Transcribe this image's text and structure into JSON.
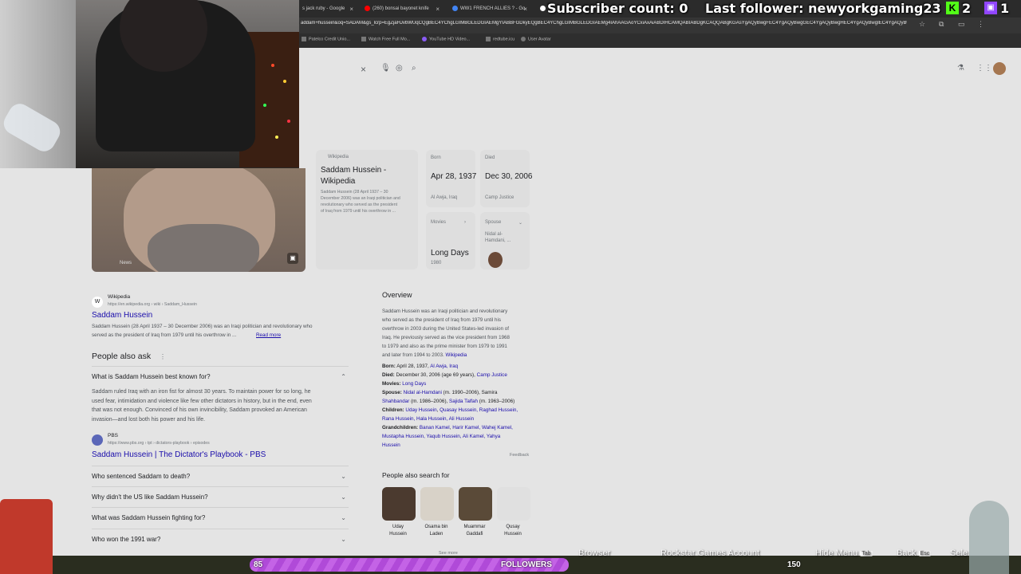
{
  "stream_overlay": {
    "subscriber_label": "Subscriber count: 0",
    "follower_label": "Last follower: newyorkgaming23",
    "kick_count": "2",
    "twitch_count": "1",
    "follow_goal_count": "85",
    "follow_goal_label": "FOLLOWERS",
    "follow_goal_target": "150",
    "hints": [
      "Browser",
      "Rockstar Games Account",
      "Hide Menu",
      "Back",
      "Sele"
    ],
    "hint_keys": [
      "Tab",
      "Esc"
    ]
  },
  "browser": {
    "tabs": [
      {
        "title": "s jack ruby - Google"
      },
      {
        "title": "(260) bonsai bayonet knife"
      },
      {
        "title": "WW1 FRENCH ALLIES ? - Go"
      },
      {
        "title": "G"
      }
    ],
    "url": "addam+hussein&oq=SADAM&gs_lcrp=EgZjaHJvbWUqCQgBEC4YChgLGIMBGLEDGIAEMgYIABBFGDkyEQgBEC4YChgLGIMBGLEDGIAEMg4IAhAAGAoYCxiAxAiABDIHCAMQABIABDgKCAQQABgKGAsYgAQyBwgFEC4YgAQyBwgGEC4YgAQyBwgHEC4YgAQyBwgIEC4YgAQyBwgJEC4YgAQyDQgKEAAYgwEYsQMYgAQyDQgLEAAYgwEYsQMYgAQyDQgMEAAYgwEYsQMYgAQyDQgNEAAYgwEYsQMYgAQyDQgOEAAYgwEYsQMYgAQyDQgPEAAYgwEYsQMYgAQyDQgQEAAYgwEYsQMYgAQyDQgREAAYgwEYsQMYgAQyDQgSEAAYgwEYsQMYgAQyDQgTEAAYgwEYsQMYgAQyDQgUEAAYgwEYsQMYgAQyDQgVEAAYgwEYsQMYgAQyDQgWEAAYgwEYsQMYgAQyDQgXEAAYgwEYsQMYgAQyDQgYEAAYgwEYsQMYgAQyDQgZEAAYgwEYsQMYgAQyDQgaEAAYgwEYsQMYgAQyDQgbEAAYgwEYsQMYgAQyDQgcEAAYgwEYsQMYgAQyDQgdEAAYgwEYsQMYgAQyDQgeEAAYgwEYsQMYgAQyDQgfEAAYgwEYsQMYgAQyDQggEAAYgwEYsQMYgAQyDQghEAAYgwEYsQMYgAQyDQgiEAAYgwEYsQMYgAQyDQgjEAAYgwEYsQMYgAQyDQgkEAAYgwEYsQMYgAQyDQglEAAYgwEYsQMYgAQyDQgmEAAYgwEYsQMYgAQyDQgnEAAYgwEYsQMYgAQyDQgoEAAYgwEYsQMYgAQyDQgpEAAYgwEYsQMYgAQyDQgqEAAYgwEYsQMYgAQyDQgrEAAYgwEYsQMYgAQyDQgsEAAYgwEYsQMYgAQyDQgtEAAYgwEYsQMYgAQyDQguEAAYgwEYsQMYgAQyDQgvEAAYgwEYsQMYgAQyDQgwEAAYgwEYsQMYgAQyDQgxEAAYgwEYsQMYgAQyDQgyEAAYgwEYsQMYgAQyDQgzEAAYgwEYsQMYgAQ",
    "bookmarks": [
      "Patelco Credit Unio...",
      "Watch Free Full Mo...",
      "YouTube HD Video...",
      "redtube.icu",
      "User Avatar"
    ]
  },
  "knowledge_panel": {
    "wiki_source": "Wikipedia",
    "wiki_title": "Saddam Hussein - Wikipedia",
    "wiki_snippet": [
      "Saddam Hussein (28 April 1937 – 30",
      "December 2006) was an Iraqi politician and",
      "revolutionary who served as the president",
      "of Iraq from 1979 until his overthrow in ..."
    ],
    "born_label": "Born",
    "born_date": "Apr 28, 1937",
    "born_place": "Al Awja, Iraq",
    "died_label": "Died",
    "died_date": "Dec 30, 2006",
    "died_place": "Camp Justice",
    "movies_label": "Movies",
    "spouse_label": "Spouse",
    "spouse_value": "Nidal al-Hamdani, ...",
    "movie_title": "Long Days",
    "movie_year": "1980",
    "photo_caption": "News"
  },
  "results": {
    "result1_source": "Wikipedia",
    "result1_url": "https://en.wikipedia.org › wiki › Saddam_Hussein",
    "result1_title": "Saddam Hussein",
    "result1_snippet": [
      "Saddam Hussein (28 April 1937 – 30 December 2006) was an Iraqi politician and revolutionary who",
      "served as the president of Iraq from 1979 until his overthrow in ..."
    ],
    "result1_readmore": "Read more",
    "paa_title": "People also ask",
    "paa_expanded_q": "What is Saddam Hussein best known for?",
    "paa_answer": [
      "Saddam ruled Iraq with an iron fist for almost 30 years. To maintain power for so long, he",
      "used fear, intimidation and violence like few other dictators in history, but in the end, even",
      "that was not enough. Convinced of his own invincibility, Saddam provoked an American",
      "invasion—and lost both his power and his life."
    ],
    "paa_source": "PBS",
    "paa_source_url": "https://www.pbs.org › tpt › dictators-playbook › episodes",
    "paa_link": "Saddam Hussein | The Dictator's Playbook - PBS",
    "paa_questions": [
      "Who sentenced Saddam to death?",
      "Why didn't the US like Saddam Hussein?",
      "What was Saddam Hussein fighting for?",
      "Who won the 1991 war?"
    ]
  },
  "overview": {
    "title": "Overview",
    "text": [
      "Saddam Hussein was an Iraqi politician and revolutionary",
      "who served as the president of Iraq from 1979 until his",
      "overthrow in 2003 during the United States-led invasion of",
      "Iraq. He previously served as the vice president from 1968",
      "to 1979 and also as the prime minister from 1979 to 1991",
      "and later from 1994 to 2003."
    ],
    "text_link": "Wikipedia",
    "facts": [
      {
        "label": "Born:",
        "value": "April 28, 1937,",
        "link": "Al Awja, Iraq"
      },
      {
        "label": "Died:",
        "value": "December 30, 2006 (age 69 years),",
        "link": "Camp Justice"
      },
      {
        "label": "Movies:",
        "value": "",
        "link": "Long Days"
      },
      {
        "label": "Spouse:",
        "value": "",
        "link": "Nidal al-Hamdani"
      },
      {
        "label": "Children:",
        "value": "",
        "link": "Uday Hussein"
      },
      {
        "label": "Grandchildren:",
        "value": "",
        "link": "Banan Kamel"
      }
    ],
    "spouse_rest": "(m. 1990–2006), Samira",
    "spouse_line2_link": "Shahbandar",
    "spouse_line2": "(m. 1986–2006),",
    "spouse_line2_b": "Sajida Talfah",
    "spouse_line2_c": "(m. 1963–2006)",
    "children_line1": "Quasay Hussein, Raghad Hussein,",
    "children_line2": "Rana Hussein, Hala Hussein, Ali Hussein",
    "grand_line1": "Harir Kamel, Wahej Kamel,",
    "grand_line2": "Mustapha Hussein, Yaqub Hussein, Ali Kamel, Yahya",
    "grand_line3": "Hussein",
    "feedback": "Feedback",
    "pas_title": "People also search for",
    "pas": [
      {
        "name1": "Uday",
        "name2": "Hussein",
        "color": "#4b3a2f"
      },
      {
        "name1": "Osama bin",
        "name2": "Laden",
        "color": "#d8d2c8"
      },
      {
        "name1": "Muammar",
        "name2": "Gaddafi",
        "color": "#5a4a38"
      },
      {
        "name1": "Qusay",
        "name2": "Hussein",
        "color": "#e0e0e0"
      }
    ],
    "see_more": "See more"
  }
}
